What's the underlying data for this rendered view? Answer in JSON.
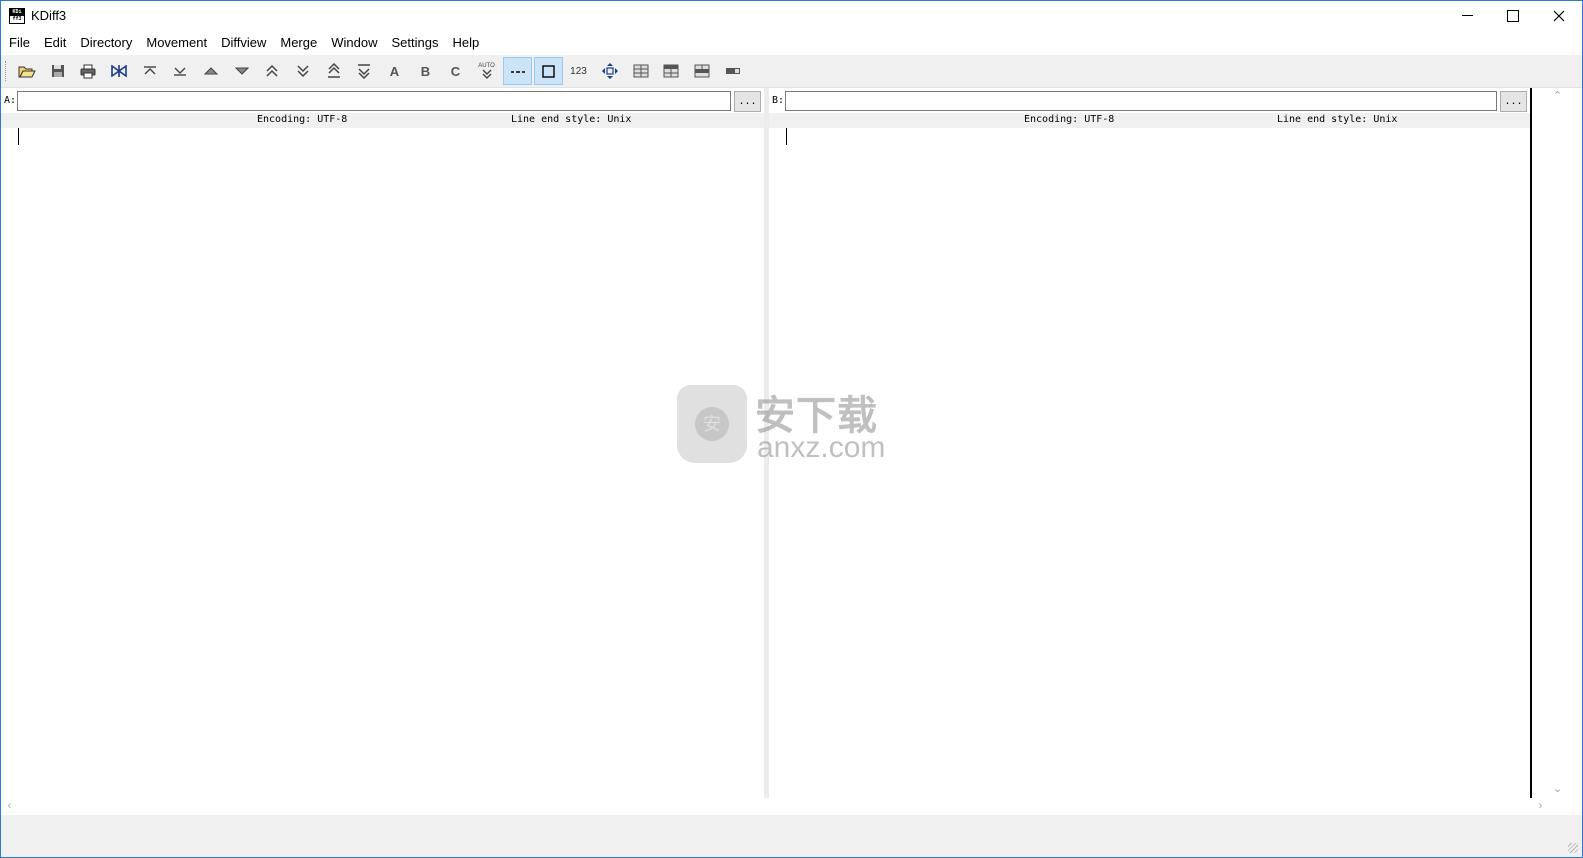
{
  "window": {
    "title": "KDiff3",
    "icon_text_top": "KDi",
    "icon_text_bottom": "ff3"
  },
  "menu": [
    "File",
    "Edit",
    "Directory",
    "Movement",
    "Diffview",
    "Merge",
    "Window",
    "Settings",
    "Help"
  ],
  "toolbar": {
    "buttons": [
      {
        "name": "open-icon"
      },
      {
        "name": "save-icon"
      },
      {
        "name": "print-icon"
      },
      {
        "name": "go-current-delta-icon"
      },
      {
        "name": "go-top-icon"
      },
      {
        "name": "go-bottom-icon"
      },
      {
        "name": "go-prev-delta-icon"
      },
      {
        "name": "go-next-delta-icon"
      },
      {
        "name": "go-prev-conflict-icon"
      },
      {
        "name": "go-next-conflict-icon"
      },
      {
        "name": "go-prev-unsolved-icon"
      },
      {
        "name": "go-next-unsolved-icon"
      },
      {
        "name": "select-a-icon",
        "text": "A"
      },
      {
        "name": "select-b-icon",
        "text": "B"
      },
      {
        "name": "select-c-icon",
        "text": "C"
      },
      {
        "name": "auto-advance-icon",
        "text": "AUTO"
      },
      {
        "name": "show-whitespace-icon",
        "active": true
      },
      {
        "name": "show-whitespace-chars-icon",
        "active": true
      },
      {
        "name": "show-line-numbers-icon",
        "text": "123"
      },
      {
        "name": "move-view-icon"
      },
      {
        "name": "split-layout-icon"
      },
      {
        "name": "split-layout-2-icon"
      },
      {
        "name": "split-layout-3-icon"
      },
      {
        "name": "toggle-overview-icon"
      }
    ]
  },
  "pane_a": {
    "label": "A:",
    "path": "",
    "browse": "...",
    "encoding": "Encoding: UTF-8",
    "line_end": "Line end style: Unix"
  },
  "pane_b": {
    "label": "B:",
    "path": "",
    "browse": "...",
    "encoding": "Encoding: UTF-8",
    "line_end": "Line end style: Unix"
  },
  "watermark": {
    "cn": "安下载",
    "en": "anxz.com",
    "shield_glyph": "安"
  }
}
